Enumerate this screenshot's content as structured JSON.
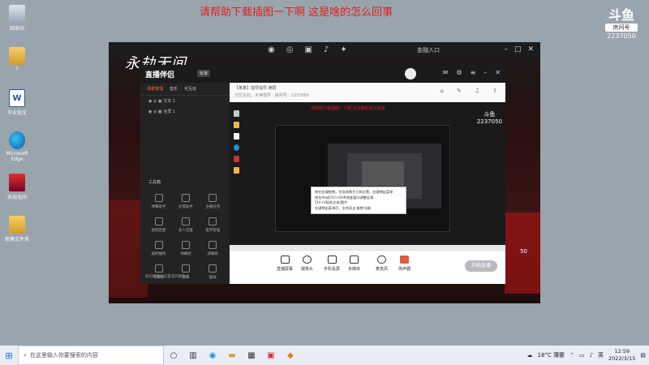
{
  "caption": "请帮助下载插图一下啊 这是啥的怎么回事",
  "desktop_icons": [
    {
      "label": "回收站",
      "icon": "recycle-bin-icon",
      "kind": "bin"
    },
    {
      "label": "?",
      "icon": "folder-icon",
      "kind": "folder"
    },
    {
      "label": "毕业论文",
      "icon": "word-document-icon",
      "kind": "word"
    },
    {
      "label": "Microsoft Edge",
      "icon": "edge-icon",
      "kind": "edge"
    },
    {
      "label": "永劫无间",
      "icon": "game-icon",
      "kind": "game"
    },
    {
      "label": "新建文件夹",
      "icon": "folder-icon",
      "kind": "folder"
    }
  ],
  "douyu": {
    "mark": "斗鱼",
    "room_label": "房间号",
    "room_number": "2237050"
  },
  "stream": {
    "title_art": "永劫无间",
    "entry_text": "金融入口",
    "side_number": "50"
  },
  "app": {
    "name": "直播伴侣",
    "version": "标准",
    "left_tabs": [
      "场景管理",
      "音乐",
      "可互动"
    ],
    "sources": [
      "文本 1",
      "全屏 1"
    ],
    "tools_title": "工具箱",
    "tools": [
      "弹幕助手",
      "房管助手",
      "主播任务",
      "视频连麦",
      "多人连麦",
      "麦序管理",
      "福利抽奖",
      "弹幕姬",
      "弹幕姬",
      "弹幕姬",
      "表情",
      "截屏"
    ],
    "bottom_hint": "如何把手机设置或开摄像头",
    "main_title": "【某某】指导指导",
    "main_tag": "横屏",
    "main_sub": "分区在此，大神指导 · 房间号：2237050",
    "notice": "请帮助下载插图一下啊 这是啥的怎么回事",
    "tip_lines": [
      "按住右键拖拽，任务前景大小和位置，右键弹出菜单",
      "按住Alt或Ctrl+Shift改变窗口调整区域",
      "Ctrl+V粘贴文本/图片",
      "右键弹出菜单后，支持双击'拖拽'功能"
    ],
    "bottom_actions": [
      {
        "label": "直播屏幕",
        "icon": "screen-icon"
      },
      {
        "label": "摄像头",
        "icon": "camera-icon"
      },
      {
        "label": "手机投屏",
        "icon": "phone-icon"
      },
      {
        "label": "多媒体",
        "icon": "media-icon"
      },
      {
        "label": "麦克风",
        "icon": "microphone-icon"
      },
      {
        "label": "扬声器",
        "icon": "speaker-icon"
      }
    ],
    "start_live": "开始直播"
  },
  "taskbar": {
    "search_placeholder": "在这里输入你要搜索的内容",
    "weather": "18°C 薄雾",
    "time": "12:59",
    "date": "2022/3/15"
  }
}
